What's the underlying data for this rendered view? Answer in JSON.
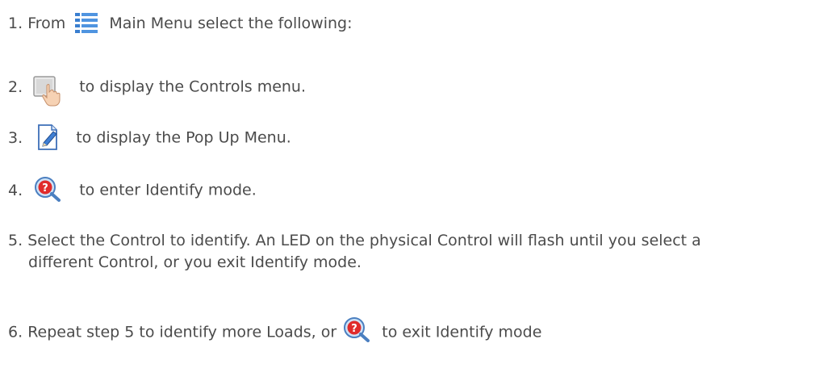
{
  "steps": [
    {
      "num": "1.",
      "pre": "From",
      "icon": "main-menu-icon",
      "post": "Main Menu select the following:"
    },
    {
      "num": "2.",
      "icon": "controls-hand-icon",
      "post": "to display the Controls menu."
    },
    {
      "num": "3.",
      "icon": "edit-pencil-icon",
      "post": "to display the Pop Up Menu."
    },
    {
      "num": "4.",
      "icon": "identify-icon",
      "post": "to enter Identify mode."
    },
    {
      "num": "5.",
      "line1": "Select the Control to identify. An LED on the physical Control will flash until you select a",
      "line2": "different Control, or you exit Identify mode."
    },
    {
      "num": "6.",
      "pre": "Repeat step 5 to identify more Loads, or",
      "icon": "identify-icon",
      "post": "to exit Identify mode"
    }
  ]
}
